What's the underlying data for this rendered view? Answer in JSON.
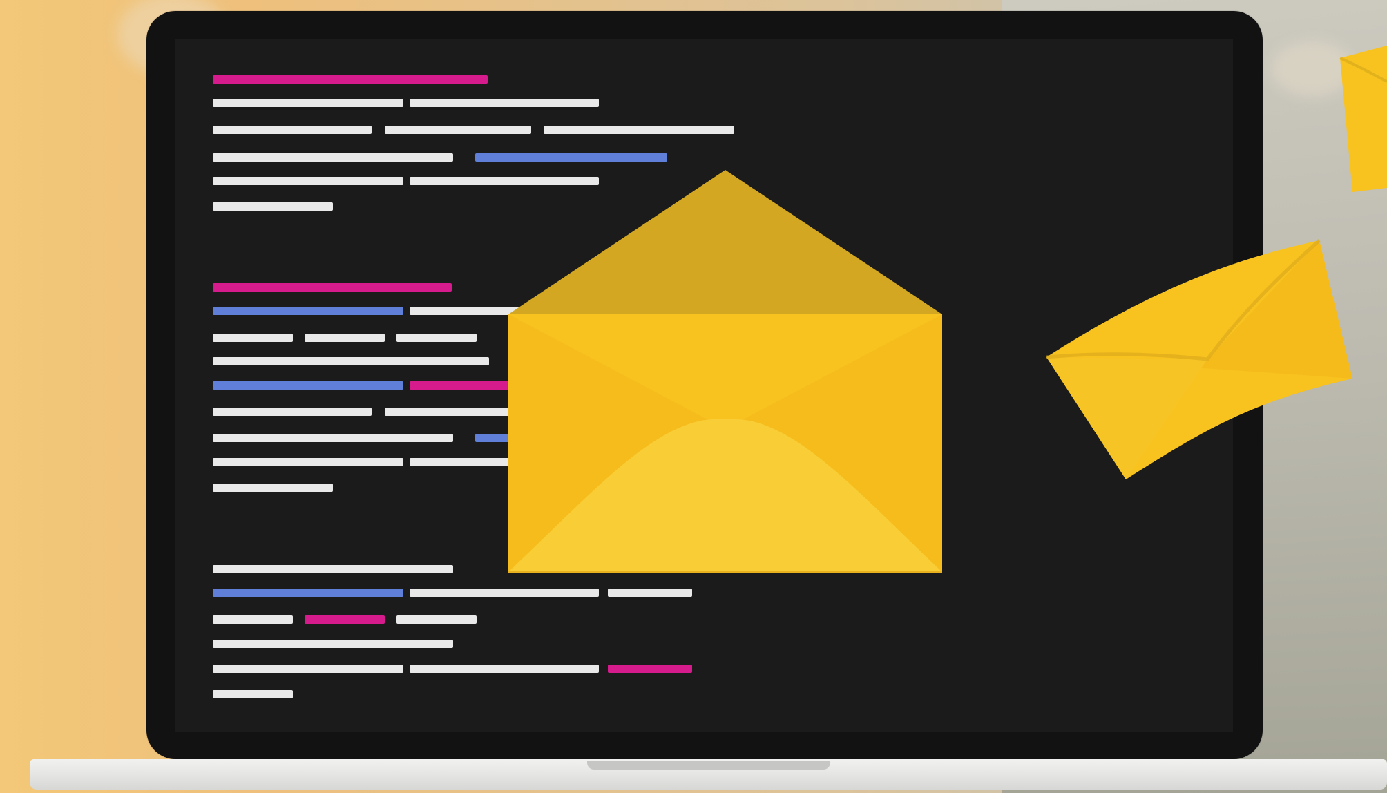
{
  "illustration": {
    "subject": "laptop-with-code-and-envelopes",
    "colors": {
      "background_warm": "#f3c878",
      "background_cool": "#aeaca0",
      "laptop_body": "#121212",
      "screen": "#1b1b1b",
      "code_white": "#e9e9e9",
      "code_magenta": "#d61b8d",
      "code_blue": "#5f7fd8",
      "envelope_yellow": "#f8c21f",
      "envelope_shadow": "#d3a623"
    },
    "icons": [
      "laptop-icon",
      "envelope-icon"
    ]
  }
}
